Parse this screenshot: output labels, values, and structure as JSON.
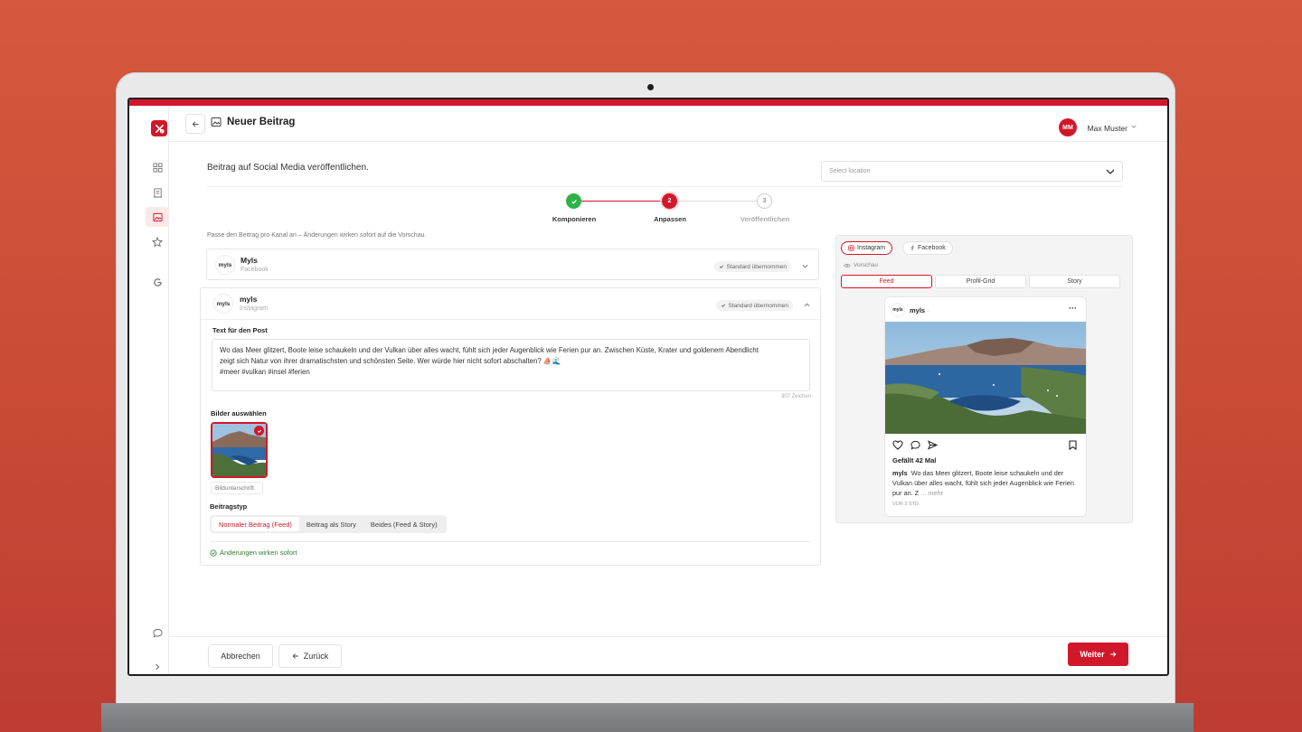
{
  "app": {
    "page_title": "Neuer Beitrag",
    "user": {
      "initials": "MM",
      "name": "Max Muster"
    },
    "brand_color": "#d1182a"
  },
  "sidebar": {
    "items": [
      {
        "icon": "dashboard-icon"
      },
      {
        "icon": "building-icon"
      },
      {
        "icon": "image-icon",
        "active": true
      },
      {
        "icon": "star-icon"
      },
      {
        "icon": "google-icon"
      }
    ],
    "bottom": [
      {
        "icon": "chat-icon"
      },
      {
        "icon": "chevron-right-icon"
      }
    ]
  },
  "main": {
    "subtitle": "Beitrag auf Social Media veröffentlichen.",
    "location_placeholder": "Select location",
    "steps": [
      {
        "label": "Komponieren",
        "number": "1",
        "state": "done"
      },
      {
        "label": "Anpassen",
        "number": "2",
        "state": "active"
      },
      {
        "label": "Veröffentlichen",
        "number": "3",
        "state": "todo"
      }
    ],
    "hint": "Passe den Beitrag pro Kanal an – Änderungen wirken sofort auf die Vorschau."
  },
  "channels": {
    "facebook": {
      "logo_text": "myls",
      "name": "Myls",
      "platform": "Facebook",
      "badge": "Standard übernommen"
    },
    "instagram": {
      "logo_text": "myls",
      "name": "myls",
      "platform": "Instagram",
      "badge": "Standard übernommen",
      "text_label": "Text für den Post",
      "post_text_line1": "Wo das Meer glitzert, Boote leise schaukeln und der Vulkan über alles wacht, fühlt sich jeder Augenblick wie Ferien pur an. Zwischen Küste, Krater und goldenem Abendlicht",
      "post_text_line2": "zeigt sich Natur von ihrer dramatischsten und schönsten Seite. Wer würde hier nicht sofort abschalten? ⛵🌊",
      "post_text_line3": "#meer #vulkan #insel #ferien",
      "char_count": "307 Zeichen",
      "images_label": "Bilder auswählen",
      "caption_placeholder": "Bildunterschrift",
      "type_label": "Beitragstyp",
      "types": [
        "Normaler Beitrag (Feed)",
        "Beitrag als Story",
        "Beides (Feed & Story)"
      ],
      "saved_note": "Änderungen wirken sofort"
    }
  },
  "preview": {
    "tabs": [
      "Instagram",
      "Facebook"
    ],
    "label": "Vorschau",
    "segments": [
      "Feed",
      "Profil-Grid",
      "Story"
    ],
    "post": {
      "logo_text": "myls",
      "user": "myls",
      "dot": "·",
      "likes": "Gefällt 42 Mal",
      "caption_user": "myls",
      "caption": "Wo das Meer glitzert, Boote leise schaukeln und der Vulkan über alles wacht, fühlt sich jeder Augenblick wie Ferien pur an. Z",
      "more": "... mehr",
      "time": "VOR 2 STD."
    }
  },
  "footer": {
    "cancel": "Abbrechen",
    "back": "Zurück",
    "next": "Weiter"
  }
}
